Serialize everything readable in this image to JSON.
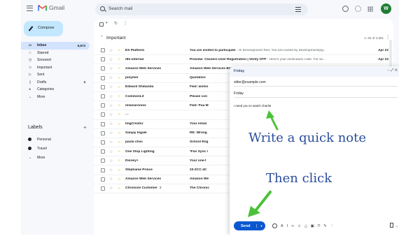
{
  "app": {
    "logo_text": "Gmail",
    "avatar_letter": "W"
  },
  "search": {
    "placeholder": "Search mail"
  },
  "compose_button": {
    "label": "Compose"
  },
  "sidebar": {
    "items": [
      {
        "label": "Inbox",
        "count": "6,973",
        "icon": "inbox-icon",
        "glyph": "▭",
        "active": true
      },
      {
        "label": "Starred",
        "count": "",
        "icon": "star-icon",
        "glyph": "☆",
        "active": false
      },
      {
        "label": "Snoozed",
        "count": "",
        "icon": "clock-icon",
        "glyph": "◷",
        "active": false
      },
      {
        "label": "Important",
        "count": "",
        "icon": "important-icon",
        "glyph": "⊃",
        "active": false
      },
      {
        "label": "Sent",
        "count": "",
        "icon": "send-icon",
        "glyph": "▷",
        "active": false
      },
      {
        "label": "Drafts",
        "count": "4",
        "icon": "draft-icon",
        "glyph": "▯",
        "active": false
      },
      {
        "label": "Categories",
        "count": "",
        "icon": "label-icon",
        "glyph": "▸",
        "active": false
      },
      {
        "label": "More",
        "count": "",
        "icon": "chevron-down-icon",
        "glyph": "⌄",
        "active": false
      }
    ],
    "labels_header": "Labels",
    "labels": [
      "Personal",
      "Travel",
      "More"
    ]
  },
  "section": {
    "title": "Important",
    "pager": "1–25 of 4,581"
  },
  "emails": [
    {
      "sender": "ES Platform",
      "subject": "You are invited to participate",
      "snippet": " - Hi Development Test, You are invited by development@g...",
      "date": "Apr 22"
    },
    {
      "sender": "dfe-internal",
      "subject": "Preview: Clizoers User Registration | Verify OTP",
      "snippet": " - Here's your verification code. For se...",
      "date": "Apr 22"
    },
    {
      "sender": "Amazon Web Services",
      "subject": "Amazon Web Services Billing Statement Available",
      "snippet": "",
      "date": "21"
    },
    {
      "sender": "polymer",
      "subject": "Quotation",
      "snippet": "",
      "date": "21"
    },
    {
      "sender": "Edward Shibanda",
      "subject": "Fwd: works",
      "snippet": "",
      "date": "13"
    },
    {
      "sender": "CommonLit",
      "subject": "Please con",
      "snippet": "",
      "date": "12"
    },
    {
      "sender": "milanaroonis",
      "subject": "Fwd: Pua M",
      "snippet": "",
      "date": "12"
    },
    {
      "sender": "- -",
      "subject": "",
      "snippet": "",
      "date": "2"
    },
    {
      "sender": "ImgCreator",
      "subject": "Your email",
      "snippet": "",
      "date": "30"
    },
    {
      "sender": "Sanjay Ingale",
      "subject": "RE: Wrong",
      "snippet": "",
      "date": "28"
    },
    {
      "sender": "paula chuc",
      "subject": "School Eng",
      "snippet": "",
      "date": "27"
    },
    {
      "sender": "One Stop Lighting",
      "subject": "*Fan Sync I",
      "snippet": "",
      "date": "27"
    },
    {
      "sender": "Disney+",
      "subject": "Your one-t",
      "snippet": "",
      "date": "27"
    },
    {
      "sender": "Stephanie Prince",
      "subject": "23-ZCC-4C",
      "snippet": "",
      "date": "27"
    },
    {
      "sender": "Amazon Web Services",
      "subject": "Amazon We",
      "snippet": "",
      "date": "25"
    },
    {
      "sender": "Chronicle Customer",
      "subject": "The Chronic",
      "snippet": "",
      "date": "24",
      "sender_count": "2"
    }
  ],
  "compose_window": {
    "title": "Friday",
    "to": "sitter@example.com",
    "subject": "Friday",
    "body": "i need you to watch charlie",
    "send_label": "Send"
  },
  "annotations": {
    "note": "Write a quick note",
    "click": "Then click"
  },
  "colors": {
    "compose_bg": "#c2e7ff",
    "send_blue": "#0b57d0",
    "active_nav": "#d3e3fd",
    "annotation": "#2a4d9c",
    "arrow_green": "#4cc23a"
  }
}
